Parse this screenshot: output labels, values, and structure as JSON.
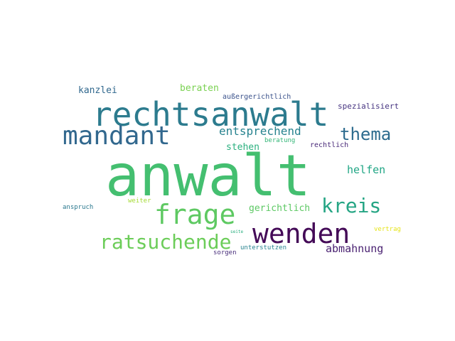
{
  "words": [
    {
      "key": "anwalt",
      "text": "anwalt",
      "color": "#44bf70"
    },
    {
      "key": "rechtsanwalt",
      "text": "rechtsanwalt",
      "color": "#2c7b8e"
    },
    {
      "key": "mandant",
      "text": "mandant",
      "color": "#32688e"
    },
    {
      "key": "frage",
      "text": "frage",
      "color": "#5ec962"
    },
    {
      "key": "wenden",
      "text": "wenden",
      "color": "#440a57"
    },
    {
      "key": "kreis",
      "text": "kreis",
      "color": "#25a584"
    },
    {
      "key": "thema",
      "text": "thema",
      "color": "#2d6b8e"
    },
    {
      "key": "ratsuchende",
      "text": "ratsuchende",
      "color": "#6ccd59"
    },
    {
      "key": "entsprechend",
      "text": "entsprechend",
      "color": "#26828e"
    },
    {
      "key": "helfen",
      "text": "helfen",
      "color": "#21a685"
    },
    {
      "key": "abmahnung",
      "text": "abmahnung",
      "color": "#481f70"
    },
    {
      "key": "gerichtlich",
      "text": "gerichtlich",
      "color": "#5cc863"
    },
    {
      "key": "stehen",
      "text": "stehen",
      "color": "#2bb07f"
    },
    {
      "key": "kanzlei",
      "text": "kanzlei",
      "color": "#31688e"
    },
    {
      "key": "beraten",
      "text": "beraten",
      "color": "#7ad151"
    },
    {
      "key": "spezialisiert",
      "text": "spezialisiert",
      "color": "#463480"
    },
    {
      "key": "aussergerichtlich",
      "text": "außergerichtlich",
      "color": "#3b528b"
    },
    {
      "key": "rechtlich",
      "text": "rechtlich",
      "color": "#482878"
    },
    {
      "key": "beratung",
      "text": "beratung",
      "color": "#35b779"
    },
    {
      "key": "anspruch",
      "text": "anspruch",
      "color": "#2a788e"
    },
    {
      "key": "weiter",
      "text": "weiter",
      "color": "#a5db36"
    },
    {
      "key": "vertrag",
      "text": "vertrag",
      "color": "#e5e419"
    },
    {
      "key": "seite",
      "text": "seite",
      "color": "#29af7f"
    },
    {
      "key": "unterstutzen",
      "text": "unterstutzen",
      "color": "#26828e"
    },
    {
      "key": "sorgen",
      "text": "sorgen",
      "color": "#472c7a"
    }
  ]
}
